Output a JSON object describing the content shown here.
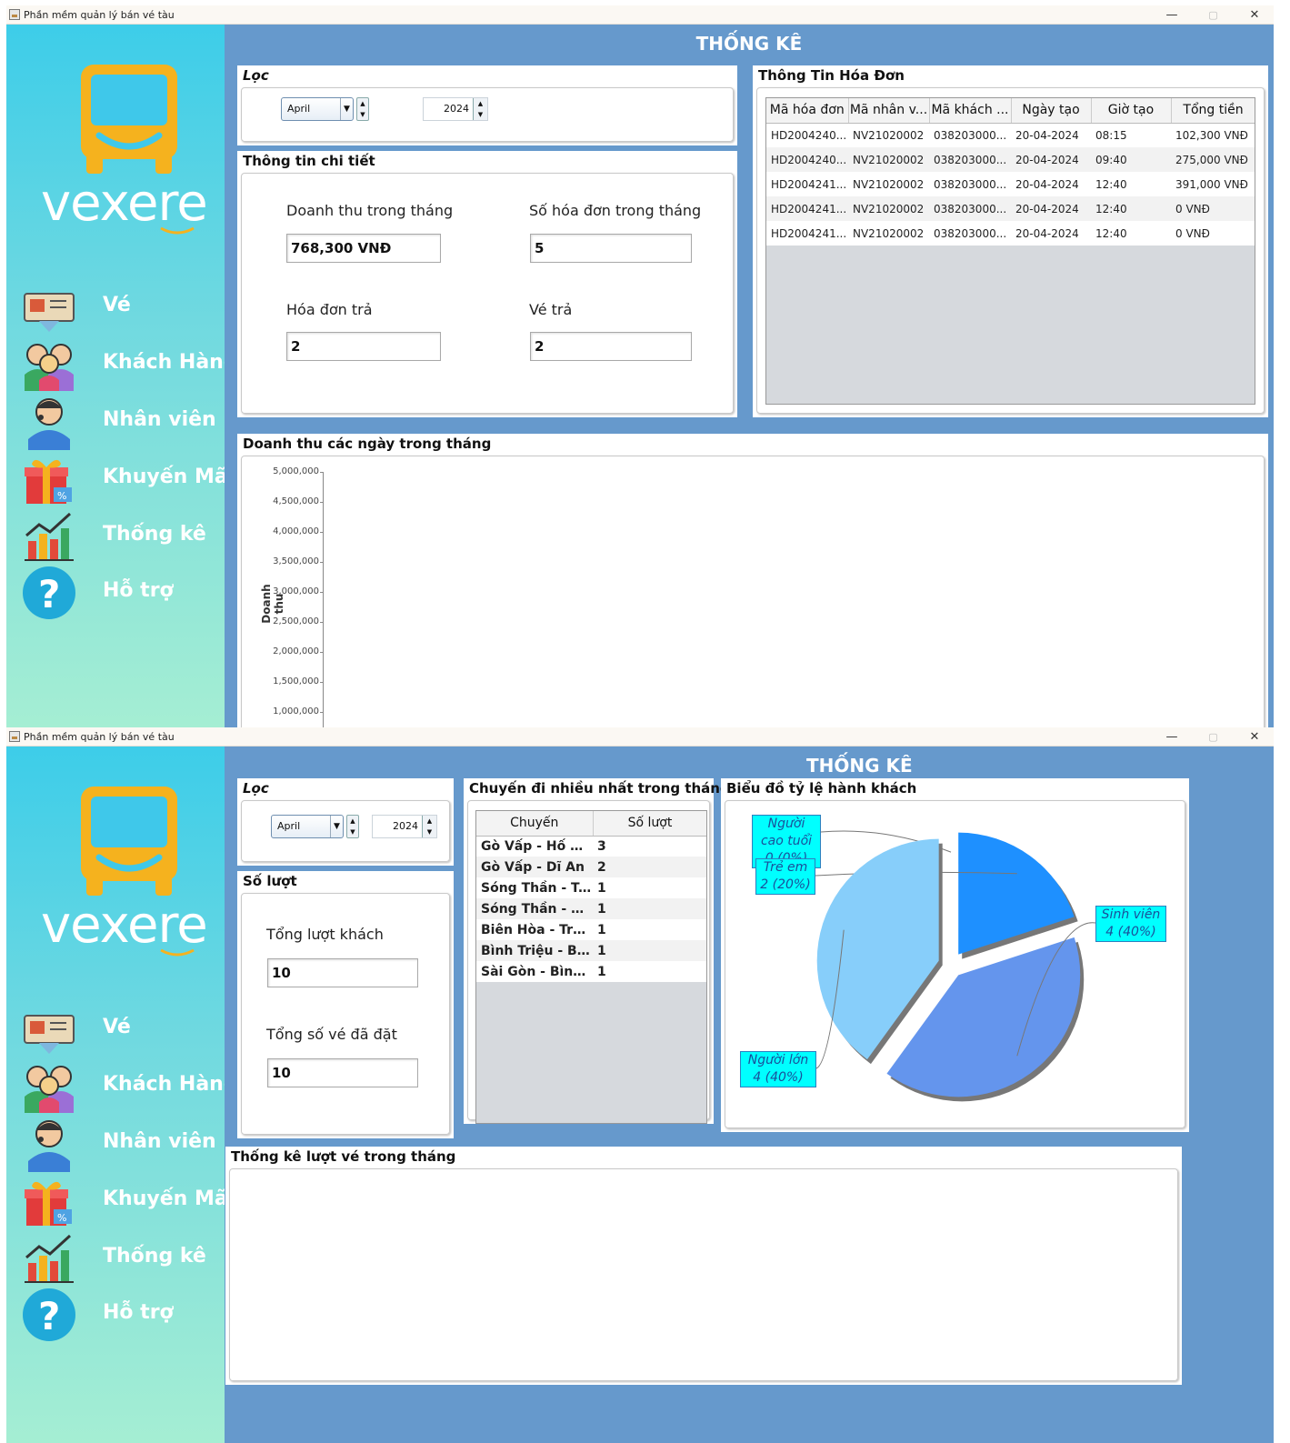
{
  "app_title": "Phần mềm quản lý bán vé tàu",
  "window_buttons": {
    "minimize": "—",
    "maximize": "▢",
    "close": "✕"
  },
  "brand": "vexere",
  "nav": [
    {
      "label": "Vé",
      "icon": "ticket-icon"
    },
    {
      "label": "Khách Hàng",
      "icon": "customers-icon"
    },
    {
      "label": "Nhân viên",
      "icon": "employee-icon"
    },
    {
      "label": "Khuyến Mãi",
      "icon": "gift-icon"
    },
    {
      "label": "Thống kê",
      "icon": "chart-icon"
    },
    {
      "label": "Hỗ trợ",
      "icon": "help-icon"
    }
  ],
  "screen1": {
    "heading": "THỐNG KÊ",
    "filter": {
      "title": "Lọc",
      "month": "April",
      "year": "2024"
    },
    "detail": {
      "title": "Thông tin chi tiết",
      "revenue_label": "Doanh thu trong tháng",
      "revenue_value": "768,300 VNĐ",
      "invoice_count_label": "Số hóa đơn trong tháng",
      "invoice_count_value": "5",
      "returned_invoice_label": "Hóa đơn trả",
      "returned_invoice_value": "2",
      "returned_ticket_label": "Vé trả",
      "returned_ticket_value": "2"
    },
    "invoices": {
      "title": "Thông Tin Hóa Đơn",
      "columns": [
        "Mã hóa đơn",
        "Mã nhân v...",
        "Mã khách ...",
        "Ngày tạo",
        "Giờ tạo",
        "Tổng tiền"
      ],
      "rows": [
        [
          "HD2004240...",
          "NV21020002",
          "038203000...",
          "20-04-2024",
          "08:15",
          "102,300 VNĐ"
        ],
        [
          "HD2004240...",
          "NV21020002",
          "038203000...",
          "20-04-2024",
          "09:40",
          "275,000 VNĐ"
        ],
        [
          "HD2004241...",
          "NV21020002",
          "038203000...",
          "20-04-2024",
          "12:40",
          "391,000 VNĐ"
        ],
        [
          "HD2004241...",
          "NV21020002",
          "038203000...",
          "20-04-2024",
          "12:40",
          "0 VNĐ"
        ],
        [
          "HD2004241...",
          "NV21020002",
          "038203000...",
          "20-04-2024",
          "12:40",
          "0 VNĐ"
        ]
      ]
    },
    "revenue_chart_title": "Doanh thu các ngày trong tháng"
  },
  "screen2": {
    "heading": "THỐNG KÊ",
    "filter": {
      "title": "Lọc",
      "month": "April",
      "year": "2024"
    },
    "counts": {
      "title": "Số lượt",
      "total_customers_label": "Tổng lượt khách",
      "total_customers_value": "10",
      "total_tickets_label": "Tổng số vé đã đặt",
      "total_tickets_value": "10"
    },
    "routes": {
      "title": "Chuyến đi nhiều nhất trong tháng",
      "columns": [
        "Chuyến",
        "Số lượt"
      ],
      "rows": [
        [
          "Gò Vấp - Hố Nai",
          "3"
        ],
        [
          "Gò Vấp - Dĩ An",
          "2"
        ],
        [
          "Sóng Thần - Tr...",
          "1"
        ],
        [
          "Sóng Thần - Dĩ...",
          "1"
        ],
        [
          "Biên Hòa - Trả...",
          "1"
        ],
        [
          "Bình Triệu - Bi...",
          "1"
        ],
        [
          "Sài Gòn - Bình ...",
          "1"
        ]
      ]
    },
    "pie_title": "Biểu đồ tỷ lệ hành khách",
    "ticket_chart_title": "Thống kê lượt vé trong tháng"
  },
  "chart_data": [
    {
      "type": "line",
      "title": "Doanh thu các ngày trong tháng",
      "ylabel": "Doanh thu",
      "ylim": [
        1000000,
        5000000
      ],
      "yticks": [
        "1,000,000",
        "1,500,000",
        "2,000,000",
        "2,500,000",
        "3,000,000",
        "3,500,000",
        "4,000,000",
        "4,500,000",
        "5,000,000"
      ],
      "series": []
    },
    {
      "type": "pie",
      "title": "Biểu đồ tỷ lệ hành khách",
      "categories": [
        "Người cao tuổi",
        "Trẻ em",
        "Sinh viên",
        "Người lớn"
      ],
      "values": [
        0,
        2,
        4,
        4
      ],
      "labels": [
        "Người cao tuổi 0 (0%)",
        "Trẻ em 2 (20%)",
        "Sinh viên 4 (40%)",
        "Người lớn 4 (40%)"
      ],
      "colors": [
        "#8a8a8a",
        "#1e90ff",
        "#6495ed",
        "#87cefa"
      ]
    },
    {
      "type": "bar",
      "title": "Thống kê lượt vé trong tháng",
      "series": []
    }
  ]
}
